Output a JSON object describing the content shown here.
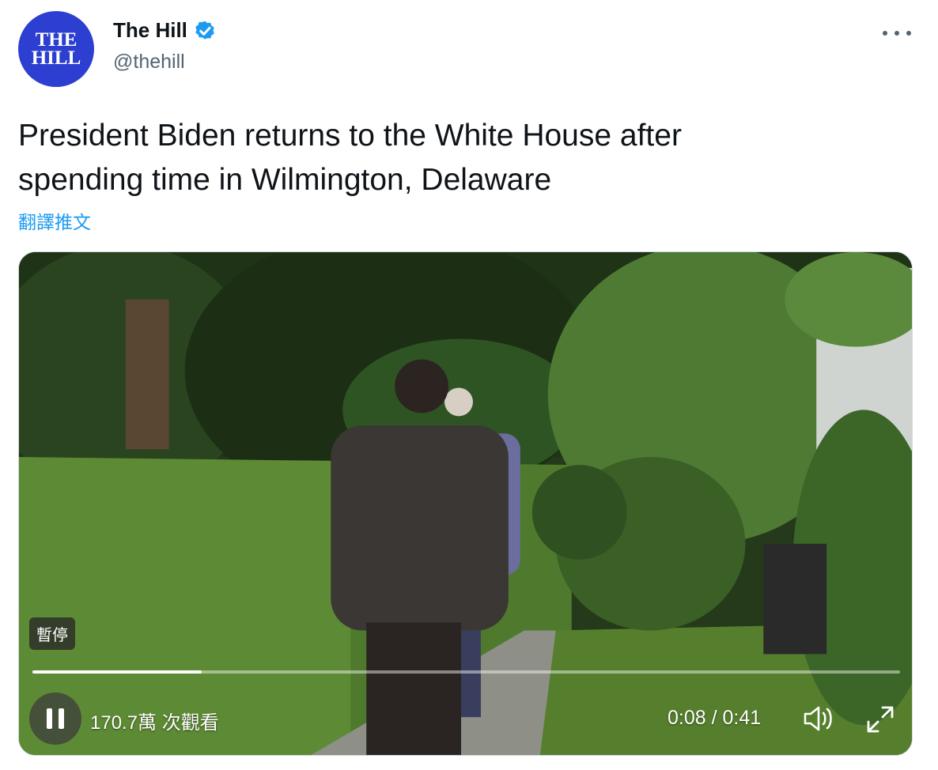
{
  "author": {
    "avatar_text_line1": "THE",
    "avatar_text_line2": "HILL",
    "display_name": "The Hill",
    "handle": "@thehill"
  },
  "tweet": {
    "text": "President Biden returns to the White House after\nspending time in Wilmington, Delaware",
    "translate_link": "翻譯推文"
  },
  "video": {
    "pause_label": "暫停",
    "views": "170.7萬 次觀看",
    "time": "0:08 / 0:41",
    "progress_fraction": 0.195
  },
  "icons": {
    "verified": "verified-badge-icon",
    "more": "more-options-icon",
    "pause": "pause-icon",
    "volume": "volume-icon",
    "fullscreen": "fullscreen-icon"
  },
  "colors": {
    "avatar_bg": "#2d3fd0",
    "link": "#1d9bf0",
    "secondary_text": "#536471"
  }
}
